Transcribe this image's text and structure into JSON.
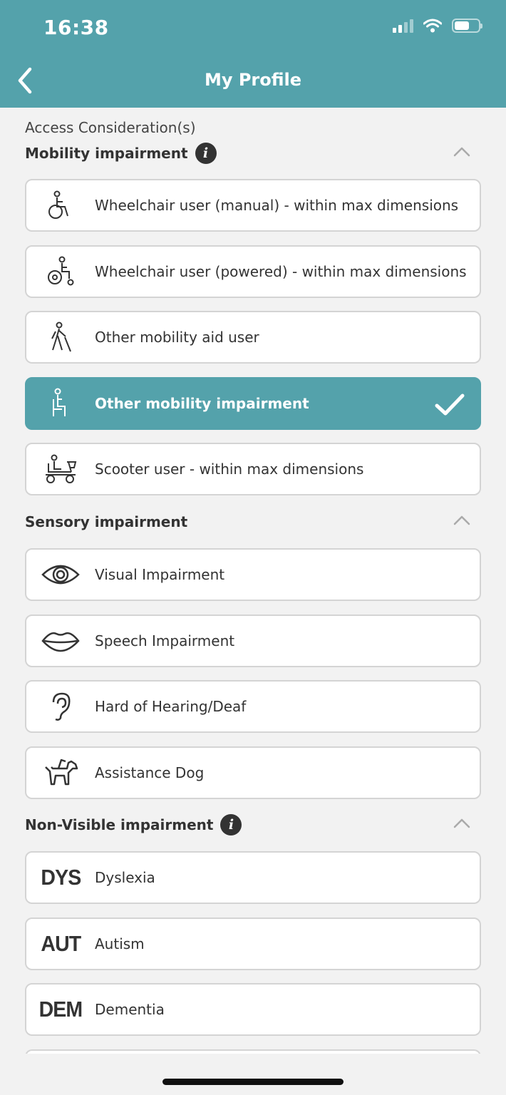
{
  "status_bar": {
    "time": "16:38"
  },
  "header": {
    "title": "My Profile"
  },
  "access_label": "Access Consideration(s)",
  "sections": [
    {
      "title": "Mobility impairment",
      "has_info": true,
      "items": [
        {
          "label": "Wheelchair user (manual) - within max dimensions",
          "icon": "manual-wheelchair-icon",
          "selected": false
        },
        {
          "label": "Wheelchair user (powered)  - within max dimensions",
          "icon": "powered-wheelchair-icon",
          "selected": false
        },
        {
          "label": "Other mobility aid user",
          "icon": "mobility-aid-icon",
          "selected": false
        },
        {
          "label": "Other mobility impairment",
          "icon": "seated-person-icon",
          "selected": true
        },
        {
          "label": "Scooter user - within max dimensions",
          "icon": "mobility-scooter-icon",
          "selected": false
        }
      ]
    },
    {
      "title": "Sensory impairment",
      "has_info": false,
      "items": [
        {
          "label": "Visual Impairment",
          "icon": "eye-icon",
          "selected": false
        },
        {
          "label": "Speech Impairment",
          "icon": "lips-icon",
          "selected": false
        },
        {
          "label": "Hard of Hearing/Deaf",
          "icon": "ear-icon",
          "selected": false
        },
        {
          "label": "Assistance Dog",
          "icon": "assistance-dog-icon",
          "selected": false
        }
      ]
    },
    {
      "title": "Non-Visible impairment",
      "has_info": true,
      "items": [
        {
          "label": "Dyslexia",
          "icon": "dys-badge-icon",
          "icon_text": "DYS",
          "selected": false
        },
        {
          "label": "Autism",
          "icon": "aut-badge-icon",
          "icon_text": "AUT",
          "selected": false
        },
        {
          "label": "Dementia",
          "icon": "dem-badge-icon",
          "icon_text": "DEM",
          "selected": false
        }
      ]
    }
  ],
  "colors": {
    "accent": "#54a2ab",
    "background": "#f2f2f2",
    "card_border": "#d4d4d4",
    "text": "#333333"
  }
}
